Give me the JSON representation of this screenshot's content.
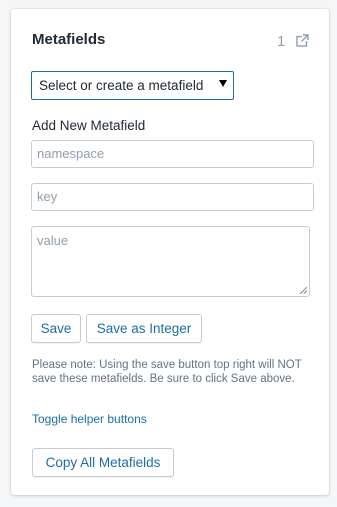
{
  "card": {
    "title": "Metafields",
    "count": "1",
    "external_icon": "external-link-icon"
  },
  "select": {
    "value": "Select or create a metafield",
    "arrow_icon": "caret-down-icon"
  },
  "add_new": {
    "label": "Add New Metafield",
    "namespace_placeholder": "namespace",
    "key_placeholder": "key",
    "value_placeholder": "value"
  },
  "buttons": {
    "save": "Save",
    "save_integer": "Save as Integer",
    "copy_all": "Copy All Metafields"
  },
  "note": "Please note: Using the save button top right will NOT save these metafields. Be sure to click Save above.",
  "toggle_link": "Toggle helper buttons",
  "colors": {
    "accent": "#1c6fa5",
    "text": "#212b36",
    "muted": "#637381",
    "border": "#c4cdd5",
    "background": "#f4f6f8"
  }
}
